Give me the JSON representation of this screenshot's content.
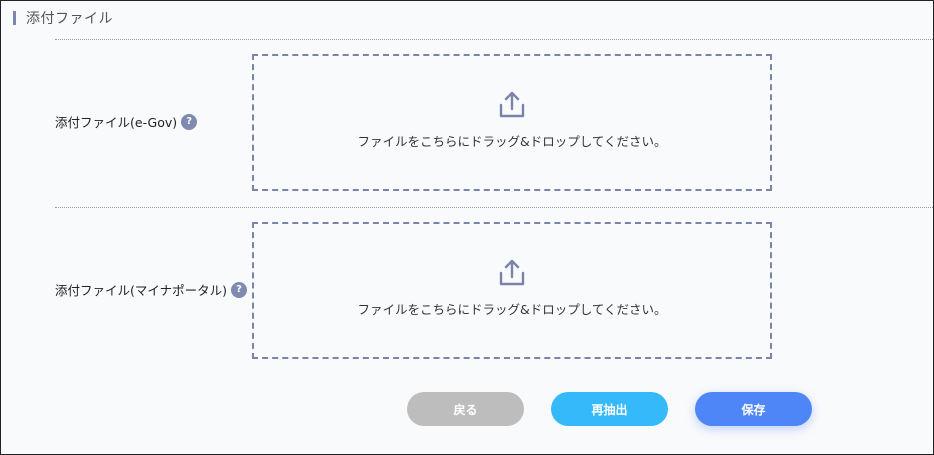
{
  "section": {
    "title": "添付ファイル"
  },
  "rows": [
    {
      "label": "添付ファイル(e-Gov)",
      "help": "?",
      "dropzone_text": "ファイルをこちらにドラッグ&ドロップしてください。",
      "icon": "upload-icon"
    },
    {
      "label": "添付ファイル(マイナポータル)",
      "help": "?",
      "dropzone_text": "ファイルをこちらにドラッグ&ドロップしてください。",
      "icon": "upload-icon"
    }
  ],
  "buttons": {
    "back": "戻る",
    "reextract": "再抽出",
    "save": "保存"
  },
  "colors": {
    "accent": "#7a86ad",
    "dashed_border": "#7a84a8",
    "button_back": "#bdbdbd",
    "button_reextract": "#35b9fb",
    "button_save": "#4f86f7"
  }
}
